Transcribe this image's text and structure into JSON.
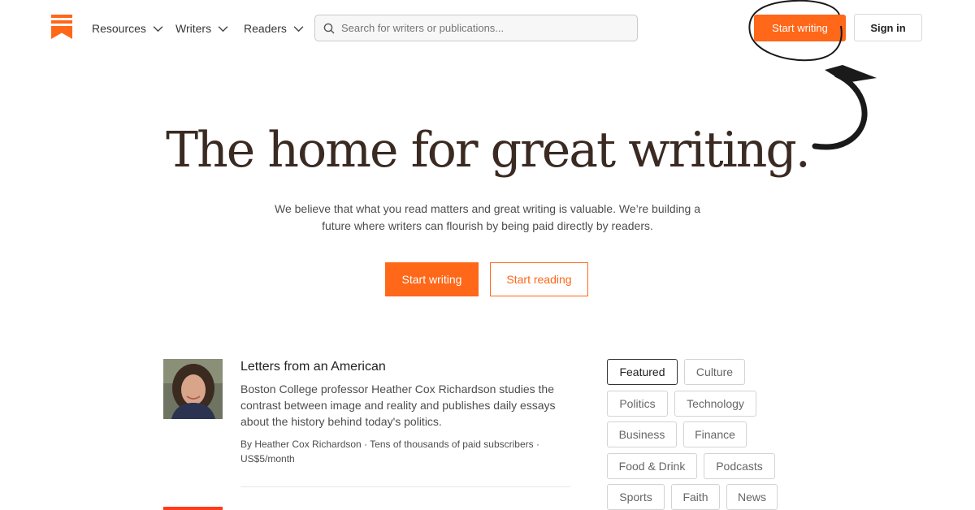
{
  "header": {
    "nav": [
      {
        "label": "Resources"
      },
      {
        "label": "Writers"
      },
      {
        "label": "Readers"
      }
    ],
    "search": {
      "placeholder": "Search for writers or publications..."
    },
    "start_writing": "Start writing",
    "sign_in": "Sign in"
  },
  "hero": {
    "title": "The home for great writing.",
    "subtitle": "We believe that what you read matters and great writing is valuable. We’re building a future where writers can flourish by being paid directly by readers.",
    "start_writing": "Start writing",
    "start_reading": "Start reading"
  },
  "featured": {
    "title": "Letters from an American",
    "description": "Boston College professor Heather Cox Richardson studies the contrast between image and reality and publishes daily essays about the history behind today's politics.",
    "meta": "By Heather Cox Richardson · Tens of thousands of paid subscribers · US$5/month"
  },
  "categories": [
    {
      "label": "Featured",
      "active": true
    },
    {
      "label": "Culture"
    },
    {
      "label": "Politics"
    },
    {
      "label": "Technology"
    },
    {
      "label": "Business"
    },
    {
      "label": "Finance"
    },
    {
      "label": "Food & Drink"
    },
    {
      "label": "Podcasts"
    },
    {
      "label": "Sports"
    },
    {
      "label": "Faith"
    },
    {
      "label": "News"
    }
  ],
  "colors": {
    "accent": "#ff6719",
    "title": "#3a2a22"
  },
  "icons": {
    "logo": "substack-logo-icon",
    "chevron": "chevron-down-icon",
    "search": "search-icon"
  }
}
